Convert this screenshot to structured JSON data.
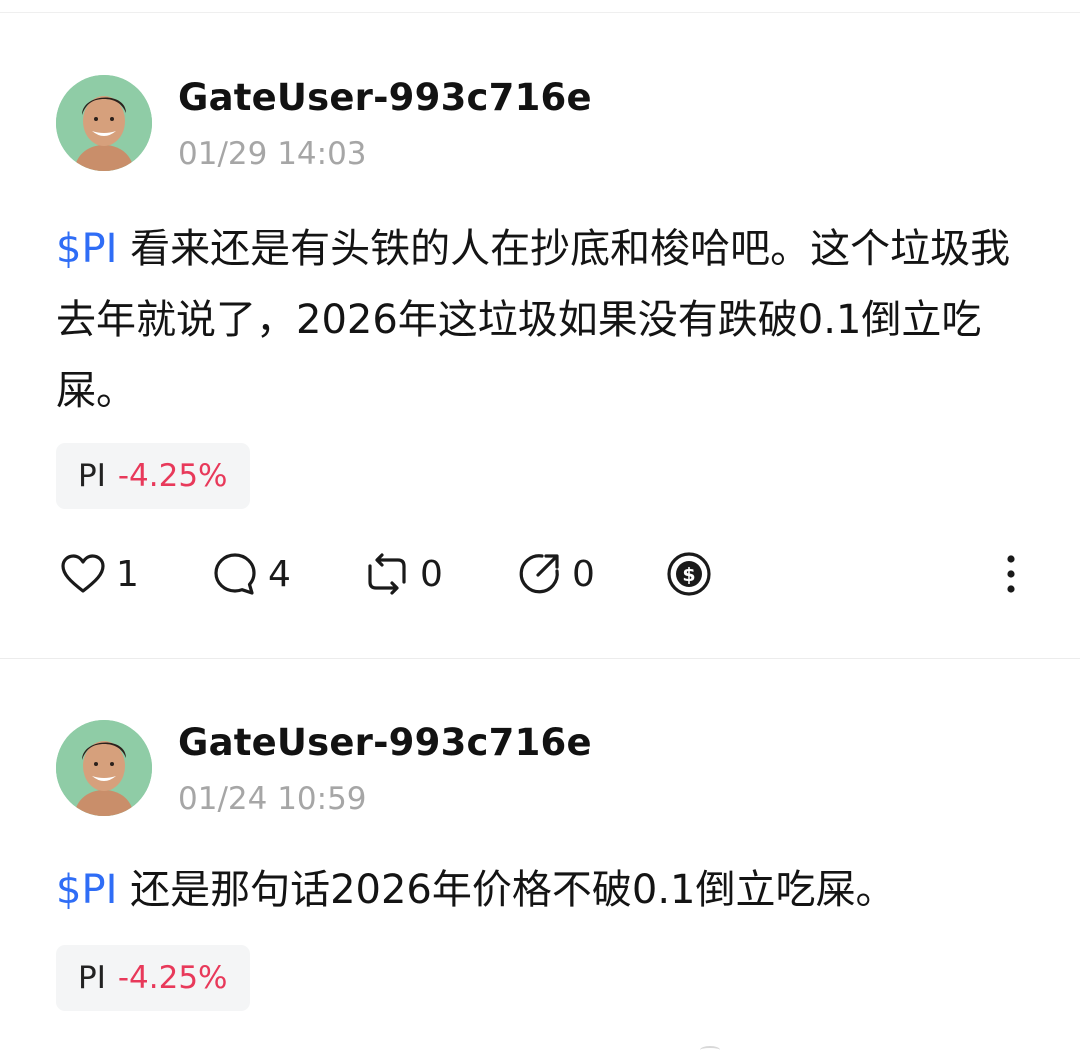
{
  "posts": [
    {
      "username": "GateUser-993c716e",
      "timestamp": "01/29 14:03",
      "ticker_link": "$PI",
      "text": " 看来还是有头铁的人在抄底和梭哈吧。这个垃圾我去年就说了，2026年这垃圾如果没有跌破0.1倒立吃屎。",
      "chip": {
        "symbol": "PI",
        "change": "-4.25%"
      },
      "actions": {
        "likes": "1",
        "comments": "4",
        "reposts": "0",
        "shares": "0"
      }
    },
    {
      "username": "GateUser-993c716e",
      "timestamp": "01/24 10:59",
      "ticker_link": "$PI",
      "text": " 还是那句话2026年价格不破0.1倒立吃屎。",
      "chip": {
        "symbol": "PI",
        "change": "-4.25%"
      }
    }
  ],
  "colors": {
    "link": "#2f6df6",
    "negative": "#e8395a",
    "muted": "#a6a6a6",
    "avatar_bg": "#8fcca6"
  },
  "icons": [
    "heart-icon",
    "comment-icon",
    "repost-icon",
    "share-icon",
    "tip-dollar-icon",
    "more-vertical-icon"
  ]
}
